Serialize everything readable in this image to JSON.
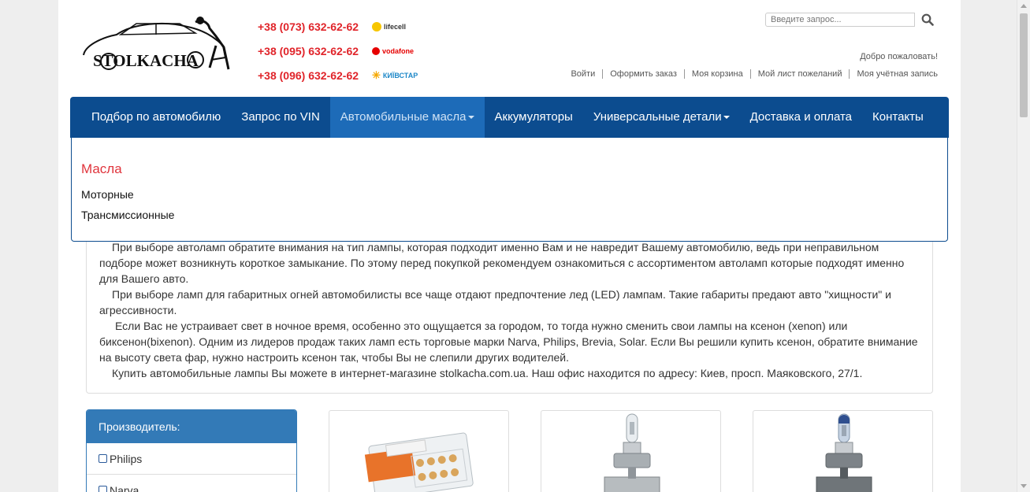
{
  "brand": {
    "name": "STOLKACHA"
  },
  "phones": [
    {
      "number": "+38 (073) 632-62-62",
      "operator": "lifecell"
    },
    {
      "number": "+38 (095) 632-62-62",
      "operator": "vodafone"
    },
    {
      "number": "+38 (096) 632-62-62",
      "operator": "КИЇВСТАР"
    }
  ],
  "search": {
    "placeholder": "Введите запрос..."
  },
  "welcome": "Добро пожаловать!",
  "toplinks": [
    "Войти",
    "Оформить заказ",
    "Моя корзина",
    "Мой лист пожеланий",
    "Моя учётная запись"
  ],
  "nav": [
    {
      "label": "Подбор по автомобилю"
    },
    {
      "label": "Запрос по VIN"
    },
    {
      "label": "Автомобильные масла",
      "dropdown": true,
      "active": true
    },
    {
      "label": "Аккумуляторы"
    },
    {
      "label": "Универсальные детали",
      "dropdown": true
    },
    {
      "label": "Доставка и оплата"
    },
    {
      "label": "Контакты"
    }
  ],
  "dropdown": {
    "title": "Масла",
    "items": [
      "Моторные",
      "Трансмиссионные"
    ]
  },
  "article": {
    "paragraphs": [
      "При выборе автоламп обратите внимания на тип лампы, которая подходит именно Вам и не навредит Вашему автомобилю, ведь при неправильном подборе может возникнуть короткое замыкание. По этому перед покупкой рекомендуем ознакомиться с ассортиментом автоламп которые подходят именно для Вашего авто.",
      "При выборе ламп для габаритных огней автомобилисты все чаще отдают предпочтение лед (LED) лампам. Такие габариты предают авто \"хищности\" и агрессивности.",
      "Если Вас не устраивает свет в ночное время, особенно это ощущается за городом, то тогда нужно сменить свои лампы на ксенон (xenon) или биксенон(bixenon). Одним из лидеров продаж таких ламп есть торговые марки Narva, Philips, Brevia, Solar. Если Вы решили купить ксенон, обратите внимание на высоту света фар, нужно настроить ксенон так, чтобы Вы не слепили других водителей.",
      "Купить автомобильные лампы Вы можете в интернет-магазине stolkacha.com.ua. Наш офис находится по адресу: Киев, просп. Маяковского, 27/1."
    ]
  },
  "filter": {
    "title": "Производитель:",
    "options": [
      "Philips",
      "Narva"
    ]
  },
  "colors": {
    "nav_bg": "#0c4c8f",
    "nav_active": "#1d6bb8",
    "accent_red": "#e0242a",
    "filter_blue": "#337ab7"
  }
}
